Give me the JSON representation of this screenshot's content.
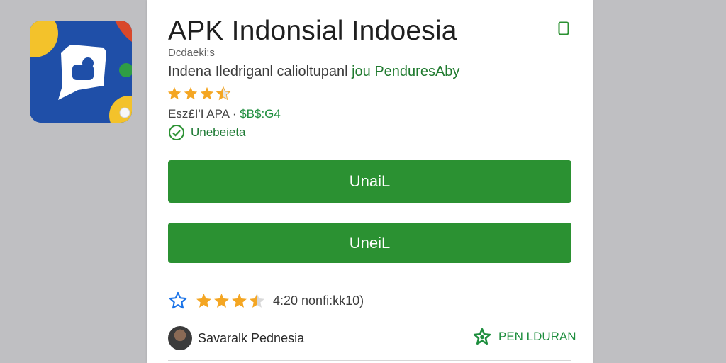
{
  "app": {
    "title": "APK Indonsial Indoesia",
    "developer": "Dcdaeki:s",
    "description_main": "Indena Iledriganl calioltupanl ",
    "description_highlight": "jou PenduresAby",
    "small_rating": 3.5,
    "meta_size": "Esz£I'I APA",
    "meta_separator": " · ",
    "meta_price": "$B$:G4",
    "verified_label": "Unebeieta"
  },
  "buttons": {
    "primary_label": "UnaiL",
    "secondary_label": "UneiL"
  },
  "rating": {
    "stars": 3.5,
    "text": "4:20 nonfi:kk10)"
  },
  "reviewer": {
    "name": "Savaralk Pednesia"
  },
  "pen_link": {
    "label": "PEN LDURAN"
  },
  "colors": {
    "accent_green": "#2b9132",
    "star_gold": "#f4a623",
    "star_outline_blue": "#1a73e8"
  },
  "icons": {
    "bookmark": "bookmark-icon",
    "verified": "check-circle-icon",
    "favorite": "star-outline-icon",
    "pen": "green-star-icon"
  }
}
